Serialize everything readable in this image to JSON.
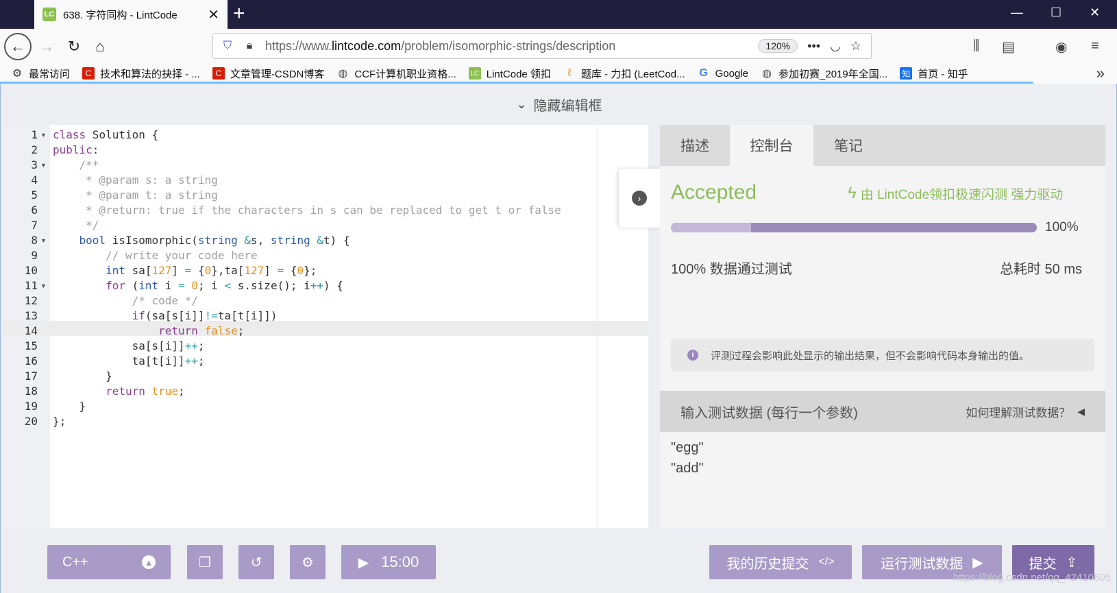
{
  "browser": {
    "tab": {
      "favicon": "LC",
      "title": "638. 字符同构 - LintCode"
    },
    "url_prefix": "https://www.",
    "url_domain": "lintcode.com",
    "url_path": "/problem/isomorphic-strings/description",
    "zoom": "120%",
    "bookmarks": [
      {
        "label": "最常访问",
        "icon": "gear-icon"
      },
      {
        "label": "技术和算法的抉择 - ...",
        "icon": "csdn-icon"
      },
      {
        "label": "文章管理-CSDN博客",
        "icon": "csdn-icon"
      },
      {
        "label": "CCF计算机职业资格...",
        "icon": "globe-icon"
      },
      {
        "label": "LintCode 领扣",
        "icon": "lintcode-icon"
      },
      {
        "label": "题库 - 力扣 (LeetCod...",
        "icon": "leetcode-icon"
      },
      {
        "label": "Google",
        "icon": "google-icon"
      },
      {
        "label": "参加初赛_2019年全国...",
        "icon": "globe-icon"
      },
      {
        "label": "首页 - 知乎",
        "icon": "zhihu-icon"
      }
    ]
  },
  "page": {
    "hide_editor": "隐藏编辑框",
    "code_lines": [
      "class Solution {",
      "public:",
      "    /**",
      "     * @param s: a string",
      "     * @param t: a string",
      "     * @return: true if the characters in s can be replaced to get t or false",
      "     */",
      "    bool isIsomorphic(string &s, string &t) {",
      "        // write your code here",
      "        int sa[127] = {0},ta[127] = {0};",
      "        for (int i = 0; i < s.size(); i++) {",
      "            /* code */",
      "            if(sa[s[i]]!=ta[t[i]])",
      "                return false;",
      "            sa[s[i]]++;",
      "            ta[t[i]]++;",
      "        }",
      "        return true;",
      "    }",
      "};"
    ],
    "line_numbers": [
      "1",
      "2",
      "3",
      "4",
      "5",
      "6",
      "7",
      "8",
      "9",
      "10",
      "11",
      "12",
      "13",
      "14",
      "15",
      "16",
      "17",
      "18",
      "19",
      "20"
    ],
    "tabs": [
      "描述",
      "控制台",
      "笔记"
    ],
    "result": {
      "status": "Accepted",
      "powered_by": "由 LintCode领扣极速闪测 强力驱动",
      "progress_pct": "100%",
      "progress_fraction": 1.0,
      "passed": "100% 数据通过测试",
      "elapsed": "总耗时 50 ms",
      "notice": "评测过程会影响此处显示的输出结果，但不会影响代码本身输出的值。"
    },
    "test_input": {
      "title": "输入测试数据 (每行一个参数)",
      "help": "如何理解测试数据？",
      "lines": [
        "\"egg\"",
        "\"add\""
      ]
    },
    "toolbar": {
      "language": "C++",
      "timer": "15:00",
      "history": "我的历史提交",
      "run": "运行测试数据",
      "submit": "提交"
    },
    "watermark": "https://blog.csdn.net/qq_42410605"
  },
  "colors": {
    "accent": "#a89bc8",
    "accent_dark": "#7f6aa8",
    "accepted": "#8cbc5c"
  }
}
